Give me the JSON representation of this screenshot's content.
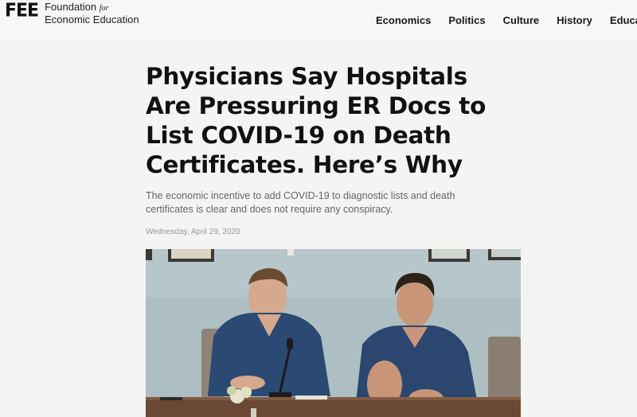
{
  "header": {
    "logo_mark": "FEE",
    "logo_line1": "Foundation",
    "logo_for": "for",
    "logo_line2": "Economic Education",
    "nav": [
      "Economics",
      "Politics",
      "Culture",
      "History",
      "Educa"
    ]
  },
  "article": {
    "title": "Physicians Say Hospitals Are Pressuring ER Docs to List COVID-19 on Death Certificates. Here’s Why",
    "subtitle": "The economic incentive to add COVID-19 to diagnostic lists and death certificates is clear and does not require any conspiracy.",
    "date": "Wednesday, April 29, 2020"
  },
  "colors": {
    "page_bg": "#f4f4f2",
    "scrub_color": "#2d4a6b"
  }
}
